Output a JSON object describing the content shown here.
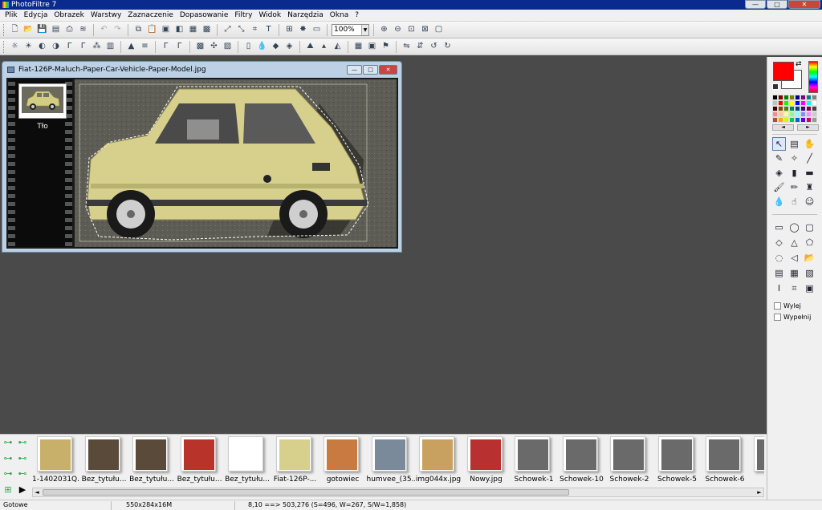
{
  "app": {
    "title": "PhotoFiltre 7"
  },
  "menu": [
    "Plik",
    "Edycja",
    "Obrazek",
    "Warstwy",
    "Zaznaczenie",
    "Dopasowanie",
    "Filtry",
    "Widok",
    "Narzędzia",
    "Okna",
    "?"
  ],
  "toolbar": {
    "zoom": "100%"
  },
  "document": {
    "title": "Fiat-126P-Maluch-Paper-Car-Vehicle-Paper-Model.jpg",
    "layer_name": "Tło"
  },
  "right_panel": {
    "foreground_color": "#ff0000",
    "background_color": "#ffffff",
    "options": [
      {
        "label": "Wylej",
        "checked": false
      },
      {
        "label": "Wypełnij",
        "checked": false
      }
    ]
  },
  "thumbnails": [
    "1-1402031Q...",
    "Bez_tytułu...",
    "Bez_tytułu...",
    "Bez_tytułu...",
    "Bez_tytułu...",
    "Fiat-126P-...",
    "gotowiec",
    "humvee_(35...",
    "img044x.jpg",
    "Nowy.jpg",
    "Schowek-1",
    "Schowek-10",
    "Schowek-2",
    "Schowek-5",
    "Schowek-6",
    "S"
  ],
  "status": {
    "state": "Gotowe",
    "size": "550x284x16M",
    "coords": "8,10 ==> 503,276 (S=496, W=267, S/W=1,858)"
  }
}
